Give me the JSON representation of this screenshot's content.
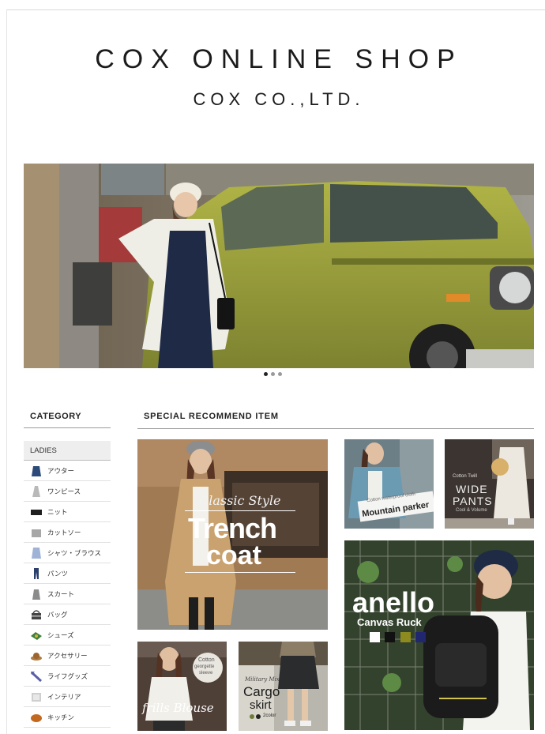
{
  "header": {
    "title": "COX ONLINE SHOP",
    "subtitle": "COX CO.,LTD."
  },
  "hero": {
    "slides": 3,
    "active_slide": 1
  },
  "sidebar": {
    "heading": "CATEGORY",
    "section": "LADIES",
    "items": [
      {
        "label": "アウター",
        "icon": "outer-icon",
        "color": "#2c4a7a"
      },
      {
        "label": "ワンピース",
        "icon": "dress-icon",
        "color": "#b9b9b9"
      },
      {
        "label": "ニット",
        "icon": "knit-icon",
        "color": "#1f1f1f"
      },
      {
        "label": "カットソー",
        "icon": "cutsew-icon",
        "color": "#a7a7a7"
      },
      {
        "label": "シャツ・ブラウス",
        "icon": "shirt-icon",
        "color": "#9fb3d6"
      },
      {
        "label": "パンツ",
        "icon": "pants-icon",
        "color": "#2a3f6b"
      },
      {
        "label": "スカート",
        "icon": "skirt-icon",
        "color": "#8b8b8b"
      },
      {
        "label": "バッグ",
        "icon": "bag-icon",
        "color": "#444444"
      },
      {
        "label": "シューズ",
        "icon": "shoes-icon",
        "color": "#3f7f3a"
      },
      {
        "label": "アクセサリー",
        "icon": "hat-icon",
        "color": "#b27a3e"
      },
      {
        "label": "ライフグッズ",
        "icon": "umbrella-icon",
        "color": "#5b5fa6"
      },
      {
        "label": "インテリア",
        "icon": "interior-icon",
        "color": "#cfcfcf"
      },
      {
        "label": "キッチン",
        "icon": "kitchen-icon",
        "color": "#c2681f"
      }
    ]
  },
  "recommend": {
    "heading": "SPECIAL  RECOMMEND  ITEM",
    "trench": {
      "script": "Classic Style",
      "line1": "Trench",
      "line2": "coat"
    },
    "mountain": {
      "small": "Cotton waterproof cloth",
      "big": "Mountain parker"
    },
    "wide": {
      "small": "Cotton Twill",
      "big1": "WIDE",
      "big2": "PANTS",
      "note": "Cool & Volume"
    },
    "anello": {
      "big": "anello",
      "sub": "Canvas Ruck"
    },
    "blouse": {
      "small1": "Cotton",
      "small2": "georgette",
      "small3": "sleeve",
      "script": "frills Blouse"
    },
    "cargo": {
      "small": "Military Mix",
      "big1": "Cargo",
      "big2": "skirt",
      "note": "2color"
    }
  }
}
